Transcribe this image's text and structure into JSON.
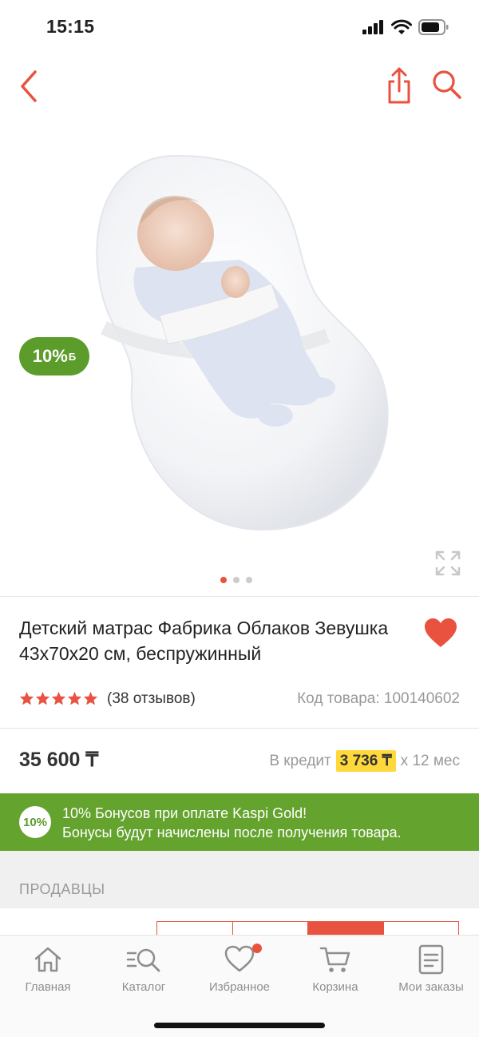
{
  "status_bar": {
    "time": "15:15"
  },
  "gallery": {
    "bonus_badge_percent": "10%",
    "bonus_badge_symbol": "Б",
    "current_page": 1,
    "total_pages": 3
  },
  "product": {
    "title": "Детский матрас Фабрика Облаков Зевушка 43x70x20 см, беспружинный",
    "rating": 5,
    "reviews": "(38 отзывов)",
    "sku": "Код товара: 100140602",
    "price": "35 600 ₸",
    "credit_label": "В кредит",
    "credit_amount": "3 736 ₸",
    "credit_term": "x 12 мес"
  },
  "kaspi_banner": {
    "badge": "10%",
    "line1": "10% Бонусов при оплате Kaspi Gold!",
    "line2": "Бонусы будут начислены после получения товара."
  },
  "sellers": {
    "title": "ПРОДАВЦЫ"
  },
  "bottom_nav": {
    "items": [
      {
        "label": "Главная",
        "icon": "home-icon"
      },
      {
        "label": "Каталог",
        "icon": "catalog-icon"
      },
      {
        "label": "Избранное",
        "icon": "heart-icon"
      },
      {
        "label": "Корзина",
        "icon": "cart-icon"
      },
      {
        "label": "Мои заказы",
        "icon": "orders-icon"
      }
    ]
  },
  "colors": {
    "accent": "#e8523f",
    "green": "#64a32e",
    "credit_highlight": "#ffd93b",
    "muted": "#999999"
  }
}
